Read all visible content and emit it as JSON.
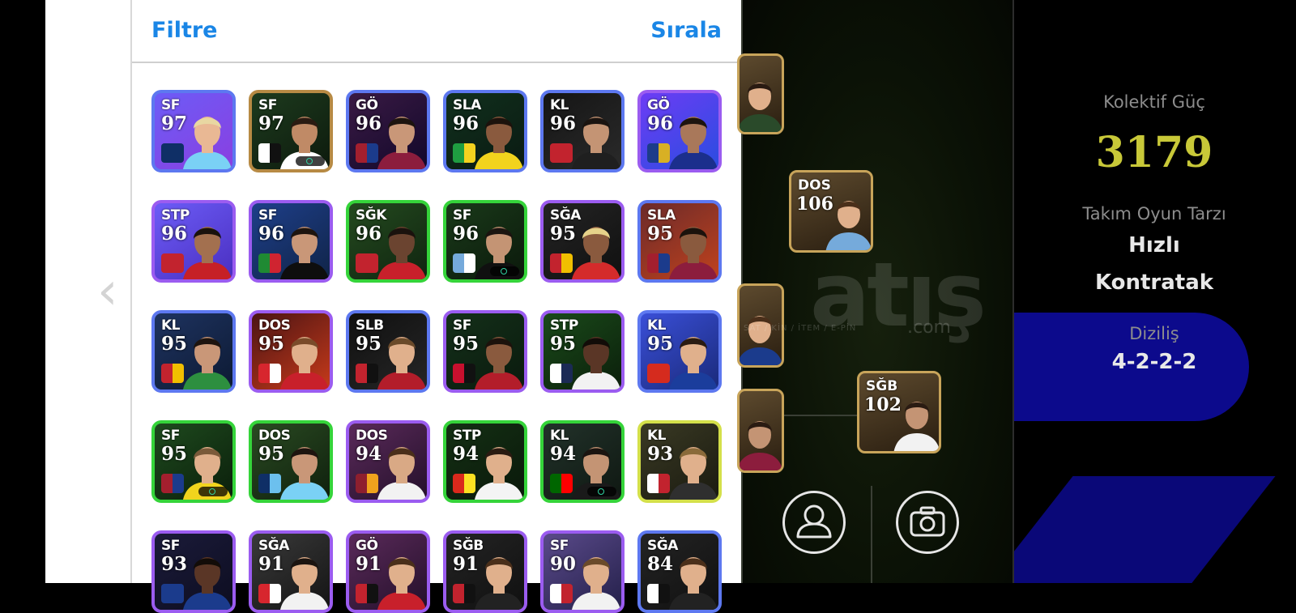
{
  "header": {
    "filter_label": "Filtre",
    "sort_label": "Sırala"
  },
  "nav": {
    "back_glyph": "‹"
  },
  "players": [
    {
      "pos": "SF",
      "rating": "97",
      "frame": "#5d78f0",
      "bg": [
        "#6c5cf7",
        "#8a3fe0"
      ],
      "emblem": [
        "#0f2f66",
        "#0f2f66"
      ],
      "skin": "#e9b894",
      "hair": "#e8d7a2",
      "shirt": "#7ad1f5"
    },
    {
      "pos": "SF",
      "rating": "97",
      "frame": "#b78a44",
      "bg": [
        "#1d3b1e",
        "#0d1a0d"
      ],
      "emblem": [
        "#ffffff",
        "#111111"
      ],
      "skin": "#c08a66",
      "hair": "#2a1b12",
      "shirt": "#ffffff",
      "boost": true
    },
    {
      "pos": "GÖ",
      "rating": "96",
      "frame": "#5d78f0",
      "bg": [
        "#3a1a44",
        "#12082a"
      ],
      "emblem": [
        "#a31f2e",
        "#1b3b8c"
      ],
      "skin": "#c99778",
      "hair": "#1d140f",
      "shirt": "#8c1d3d"
    },
    {
      "pos": "SLA",
      "rating": "96",
      "frame": "#5d78f0",
      "bg": [
        "#11301d",
        "#0a1a12"
      ],
      "emblem": [
        "#1f9d41",
        "#f4d21f"
      ],
      "skin": "#8a5a3e",
      "hair": "#1c120c",
      "shirt": "#f2d31d"
    },
    {
      "pos": "KL",
      "rating": "96",
      "frame": "#5d78f0",
      "bg": [
        "#151515",
        "#2a2a2a"
      ],
      "emblem": [
        "#c2232e",
        "#c2232e"
      ],
      "skin": "#c49474",
      "hair": "#1b1410",
      "shirt": "#1f1f1f"
    },
    {
      "pos": "GÖ",
      "rating": "96",
      "frame": "#9b5cf0",
      "bg": [
        "#6d3cf5",
        "#2a4de0"
      ],
      "emblem": [
        "#1c3c8a",
        "#d8b024"
      ],
      "skin": "#a9785a",
      "hair": "#1c140f",
      "shirt": "#1b2f8c"
    },
    {
      "pos": "STP",
      "rating": "96",
      "frame": "#9b5cf0",
      "bg": [
        "#6c5cf7",
        "#4a2fc0"
      ],
      "emblem": [
        "#c2232e",
        "#c2232e"
      ],
      "skin": "#a3704f",
      "hair": "#1a120d",
      "shirt": "#c62026"
    },
    {
      "pos": "SF",
      "rating": "96",
      "frame": "#9b5cf0",
      "bg": [
        "#1e3f8a",
        "#102448"
      ],
      "emblem": [
        "#1f8a33",
        "#cf2430"
      ],
      "skin": "#c99778",
      "hair": "#1d140f",
      "shirt": "#0e0e0e"
    },
    {
      "pos": "SĞK",
      "rating": "96",
      "frame": "#35d43a",
      "bg": [
        "#244a1f",
        "#102510"
      ],
      "emblem": [
        "#c2232e",
        "#c2232e"
      ],
      "skin": "#6b4430",
      "hair": "#1a120d",
      "shirt": "#c8202b"
    },
    {
      "pos": "SF",
      "rating": "96",
      "frame": "#35d43a",
      "bg": [
        "#1a3a1a",
        "#0b190b"
      ],
      "emblem": [
        "#75aadb",
        "#ffffff"
      ],
      "skin": "#c49474",
      "hair": "#1b1410",
      "shirt": "#101010",
      "boost": true
    },
    {
      "pos": "SĞA",
      "rating": "95",
      "frame": "#9b5cf0",
      "bg": [
        "#242424",
        "#101010"
      ],
      "emblem": [
        "#c2232e",
        "#f1bf00"
      ],
      "skin": "#8a5a3e",
      "hair": "#e6d28a",
      "shirt": "#d42b2b"
    },
    {
      "pos": "SLA",
      "rating": "95",
      "frame": "#5d78f0",
      "bg": [
        "#6b2a2a",
        "#c0421d"
      ],
      "emblem": [
        "#a31f2e",
        "#1b3b8c"
      ],
      "skin": "#8a5a3e",
      "hair": "#1c120c",
      "shirt": "#8c1d3d"
    },
    {
      "pos": "KL",
      "rating": "95",
      "frame": "#5d78f0",
      "bg": [
        "#1e3360",
        "#0d1a33"
      ],
      "emblem": [
        "#c2232e",
        "#f1bf00"
      ],
      "skin": "#c99778",
      "hair": "#1d140f",
      "shirt": "#2d8f3f"
    },
    {
      "pos": "DOS",
      "rating": "95",
      "frame": "#9b5cf0",
      "bg": [
        "#4a1414",
        "#c73a1a"
      ],
      "emblem": [
        "#d7262e",
        "#ffffff"
      ],
      "skin": "#e0b08c",
      "hair": "#7a4b2a",
      "shirt": "#c8202b"
    },
    {
      "pos": "SLB",
      "rating": "95",
      "frame": "#5d78f0",
      "bg": [
        "#101010",
        "#262626"
      ],
      "emblem": [
        "#c2232e",
        "#111111"
      ],
      "skin": "#e0b08c",
      "hair": "#6a4a2a",
      "shirt": "#b31d2a"
    },
    {
      "pos": "SF",
      "rating": "95",
      "frame": "#9b5cf0",
      "bg": [
        "#14301a",
        "#0a1a0d"
      ],
      "emblem": [
        "#c8102e",
        "#111111"
      ],
      "skin": "#8a5a3e",
      "hair": "#1c120c",
      "shirt": "#b31d2a"
    },
    {
      "pos": "STP",
      "rating": "95",
      "frame": "#9b5cf0",
      "bg": [
        "#1a4a1a",
        "#0b1f0b"
      ],
      "emblem": [
        "#ffffff",
        "#1b2a55"
      ],
      "skin": "#5a3626",
      "hair": "#120c08",
      "shirt": "#f2f2f2"
    },
    {
      "pos": "KL",
      "rating": "95",
      "frame": "#5d78f0",
      "bg": [
        "#3a4fd8",
        "#1a2a7a"
      ],
      "emblem": [
        "#d52b1e",
        "#d52b1e"
      ],
      "skin": "#e0b08c",
      "hair": "#2a1b12",
      "shirt": "#1b3d9c"
    },
    {
      "pos": "SF",
      "rating": "95",
      "frame": "#35d43a",
      "bg": [
        "#1e4a1e",
        "#0b1f0b"
      ],
      "emblem": [
        "#a31f2e",
        "#1b3b8c"
      ],
      "skin": "#e0b08c",
      "hair": "#7a5a3a",
      "shirt": "#f1d41d",
      "boost": true
    },
    {
      "pos": "DOS",
      "rating": "95",
      "frame": "#35d43a",
      "bg": [
        "#2a4a22",
        "#0f200d"
      ],
      "emblem": [
        "#0f2f66",
        "#6cc0ee"
      ],
      "skin": "#c99778",
      "hair": "#1d140f",
      "shirt": "#7ad1f5"
    },
    {
      "pos": "DOS",
      "rating": "94",
      "frame": "#9b5cf0",
      "bg": [
        "#5a2a5a",
        "#24102a"
      ],
      "emblem": [
        "#8e1f2e",
        "#f0a21d"
      ],
      "skin": "#d9a985",
      "hair": "#4a2f1a",
      "shirt": "#f2f2f2"
    },
    {
      "pos": "STP",
      "rating": "94",
      "frame": "#35d43a",
      "bg": [
        "#143014",
        "#0a180a"
      ],
      "emblem": [
        "#da291c",
        "#fbe122"
      ],
      "skin": "#e0b08c",
      "hair": "#2a1b12",
      "shirt": "#f4f4f4"
    },
    {
      "pos": "KL",
      "rating": "94",
      "frame": "#35d43a",
      "bg": [
        "#22322a",
        "#0f1812"
      ],
      "emblem": [
        "#006600",
        "#ff0000"
      ],
      "skin": "#c49474",
      "hair": "#1b1410",
      "shirt": "#1a1a1a",
      "boost": true
    },
    {
      "pos": "KL",
      "rating": "93",
      "frame": "#d4e04a",
      "bg": [
        "#3a3a24",
        "#1a1a10"
      ],
      "emblem": [
        "#ffffff",
        "#c2232e"
      ],
      "skin": "#e0b08c",
      "hair": "#8a6a3a",
      "shirt": "#2f2f2f"
    },
    {
      "pos": "SF",
      "rating": "93",
      "frame": "#9b5cf0",
      "bg": [
        "#1b1b3a",
        "#0d0d20"
      ],
      "emblem": [
        "#1b3b8c",
        "#1b3b8c"
      ],
      "skin": "#5a3626",
      "hair": "#120c08",
      "shirt": "#1b3b8c"
    },
    {
      "pos": "SĞA",
      "rating": "91",
      "frame": "#9b5cf0",
      "bg": [
        "#3a3a3a",
        "#141414"
      ],
      "emblem": [
        "#d7262e",
        "#ffffff"
      ],
      "skin": "#e0b08c",
      "hair": "#1b1410",
      "shirt": "#f2f2f2"
    },
    {
      "pos": "GÖ",
      "rating": "91",
      "frame": "#9b5cf0",
      "bg": [
        "#5a2a5a",
        "#24102a"
      ],
      "emblem": [
        "#c2232e",
        "#111111"
      ],
      "skin": "#e0b08c",
      "hair": "#4a2f1a",
      "shirt": "#c8202b"
    },
    {
      "pos": "SĞB",
      "rating": "91",
      "frame": "#9b5cf0",
      "bg": [
        "#242424",
        "#101010"
      ],
      "emblem": [
        "#c2232e",
        "#111111"
      ],
      "skin": "#e0b08c",
      "hair": "#4a2f1a",
      "shirt": "#222222"
    },
    {
      "pos": "SF",
      "rating": "90",
      "frame": "#9b5cf0",
      "bg": [
        "#5a4a8a",
        "#24204a"
      ],
      "emblem": [
        "#ffffff",
        "#c2232e"
      ],
      "skin": "#e0b08c",
      "hair": "#6a4a2a",
      "shirt": "#f2f2f2"
    },
    {
      "pos": "SĞA",
      "rating": "84",
      "frame": "#5d78f0",
      "bg": [
        "#242424",
        "#101010"
      ],
      "emblem": [
        "#ffffff",
        "#111111"
      ],
      "skin": "#e0b08c",
      "hair": "#4a2f1a",
      "shirt": "#222222"
    }
  ],
  "pitch_cards": [
    {
      "pos": "",
      "rating": "",
      "frame": "#c8a45a",
      "skin": "#e0b08c",
      "hair": "#2a1b12",
      "shirt": "#2a4a2a"
    },
    {
      "pos": "DOS",
      "rating": "106",
      "frame": "#c8a45a",
      "skin": "#e0b08c",
      "hair": "#4a2f1a",
      "shirt": "#75aadb"
    },
    {
      "pos": "",
      "rating": "",
      "frame": "#c8a45a",
      "skin": "#e0b08c",
      "hair": "#4a2f1a",
      "shirt": "#1b3b8c"
    },
    {
      "pos": "",
      "rating": "",
      "frame": "#c8a45a",
      "skin": "#c49474",
      "hair": "#2a1b12",
      "shirt": "#8c1d3d"
    },
    {
      "pos": "SĞB",
      "rating": "102",
      "frame": "#c8a45a",
      "skin": "#c49474",
      "hair": "#2a1b12",
      "shirt": "#f2f2f2"
    }
  ],
  "watermark": {
    "text": "atış",
    "domain": ".com",
    "tagline": "SAT / KİN / İTEM / E-PİN"
  },
  "pitch_buttons": {
    "profile_icon": "user-icon",
    "camera_icon": "camera-icon"
  },
  "info": {
    "strength_label": "Kolektif Güç",
    "strength_value": "3179",
    "style_label": "Takım Oyun Tarzı",
    "style_value_line1": "Hızlı",
    "style_value_line2": "Kontratak",
    "formation_label": "Diziliş",
    "formation_value": "4-2-2-2"
  },
  "colors": {
    "accent_blue": "#1a86e6",
    "strength_yellow": "#c8c838",
    "panel_blue": "#0c0a8c"
  }
}
